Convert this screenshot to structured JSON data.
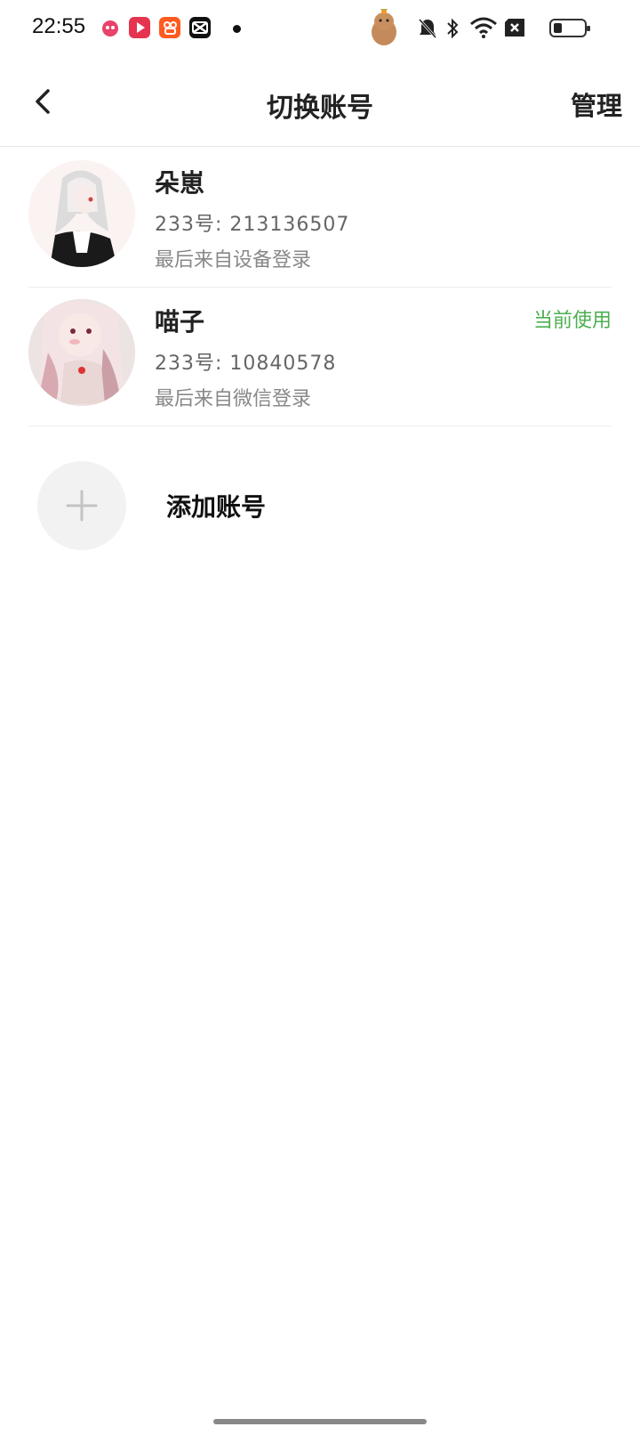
{
  "status_bar": {
    "time": "22:55",
    "icons": [
      "app-cat-icon",
      "video-play-icon",
      "kuaishou-icon",
      "capcut-icon",
      "notification-dot",
      "capybara-icon",
      "mute-bell-icon",
      "bluetooth-icon",
      "wifi-icon",
      "no-sim-icon",
      "battery-icon"
    ],
    "battery_level": 0.2
  },
  "header": {
    "title": "切换账号",
    "manage_label": "管理"
  },
  "accounts": [
    {
      "name": "朵崽",
      "id_text": "233号: 213136507",
      "login_text": "最后来自设备登录",
      "current_label": ""
    },
    {
      "name": "喵子",
      "id_text": "233号: 10840578",
      "login_text": "最后来自微信登录",
      "current_label": "当前使用"
    }
  ],
  "add_account": {
    "label": "添加账号"
  },
  "colors": {
    "accent_green": "#4caf50",
    "divider": "#ececec"
  }
}
